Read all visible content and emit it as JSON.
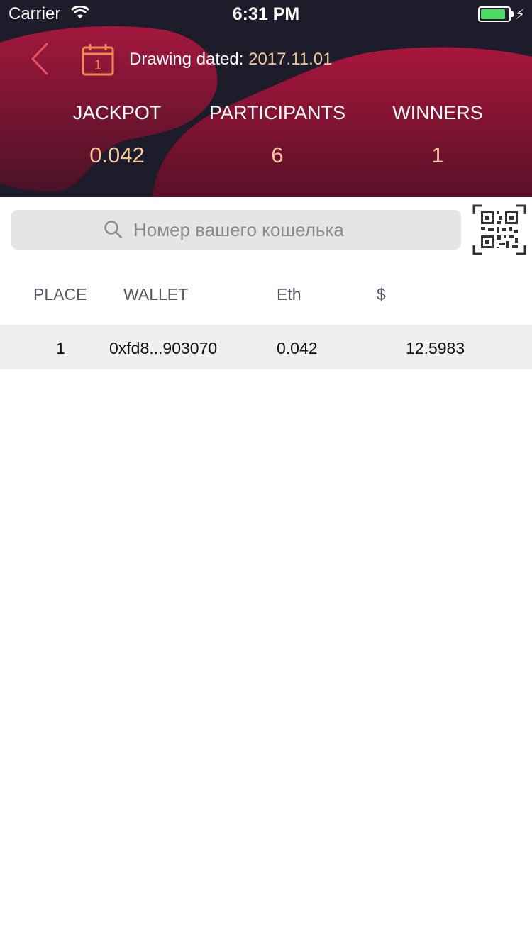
{
  "status_bar": {
    "carrier": "Carrier",
    "time": "6:31 PM",
    "battery_color": "#4cd964"
  },
  "header": {
    "back_icon": "chevron-left-icon",
    "calendar_icon": "calendar-icon",
    "calendar_day": "1",
    "drawing_label": "Drawing dated: ",
    "drawing_date": "2017.11.01",
    "accent_color": "#f6c79a",
    "brand_color": "#a01a3c",
    "stats": [
      {
        "label": "JACKPOT",
        "value": "0.042"
      },
      {
        "label": "PARTICIPANTS",
        "value": "6"
      },
      {
        "label": "WINNERS",
        "value": "1"
      }
    ]
  },
  "search": {
    "placeholder": "Номер вашего кошелька",
    "value": "",
    "icon": "search-icon",
    "qr_icon": "qr-code-icon"
  },
  "table": {
    "columns": [
      "PLACE",
      "WALLET",
      "Eth",
      "$"
    ],
    "rows": [
      {
        "place": "1",
        "wallet": "0xfd8...903070",
        "eth": "0.042",
        "usd": "12.5983"
      }
    ]
  }
}
